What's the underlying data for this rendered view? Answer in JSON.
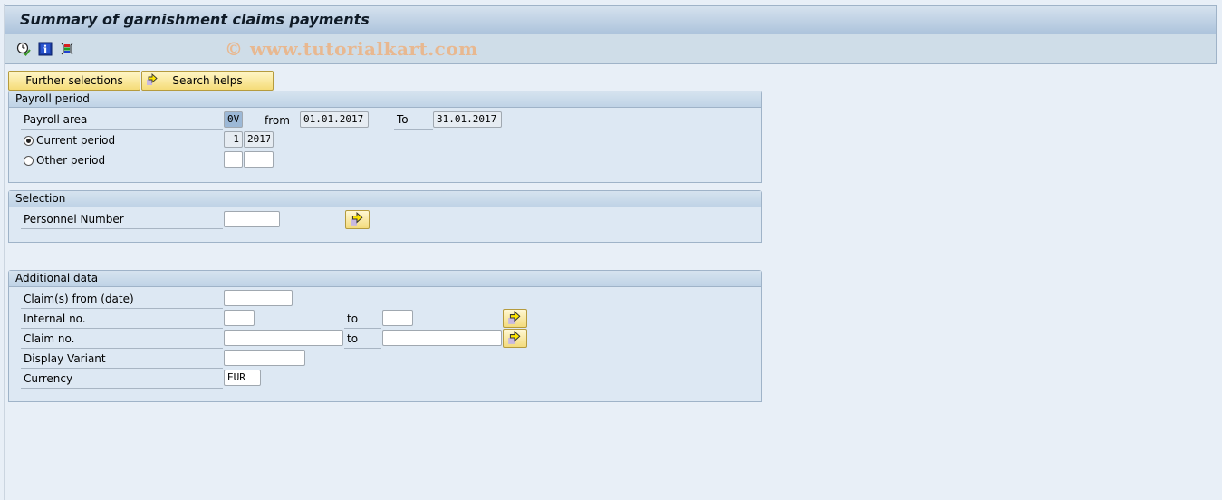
{
  "window": {
    "title": "Summary of garnishment claims payments",
    "watermark": "© www.tutorialkart.com"
  },
  "toolbar": {
    "icons": [
      "execute-clock-icon",
      "info-icon",
      "selection-options-icon"
    ]
  },
  "buttons": {
    "further_selections": "Further selections",
    "search_helps": "Search helps"
  },
  "payroll_period": {
    "header": "Payroll period",
    "payroll_area_label": "Payroll area",
    "payroll_area_value": "0V",
    "from_label": "from",
    "from_value": "01.01.2017",
    "to_label": "To",
    "to_value": "31.01.2017",
    "current_period_label": "Current period",
    "current_period_selected": true,
    "current_period_number": "1",
    "current_period_year": "2017",
    "other_period_label": "Other period",
    "other_period_selected": false,
    "other_period_number": "",
    "other_period_year": ""
  },
  "selection": {
    "header": "Selection",
    "personnel_number_label": "Personnel Number",
    "personnel_number_value": ""
  },
  "additional_data": {
    "header": "Additional data",
    "claims_from_label": "Claim(s) from (date)",
    "claims_from_value": "",
    "internal_no_label": "Internal no.",
    "internal_no_from": "",
    "internal_no_to_label": "to",
    "internal_no_to": "",
    "claim_no_label": "Claim no.",
    "claim_no_from": "",
    "claim_no_to_label": "to",
    "claim_no_to": "",
    "display_variant_label": "Display Variant",
    "display_variant_value": "",
    "currency_label": "Currency",
    "currency_value": "EUR"
  }
}
